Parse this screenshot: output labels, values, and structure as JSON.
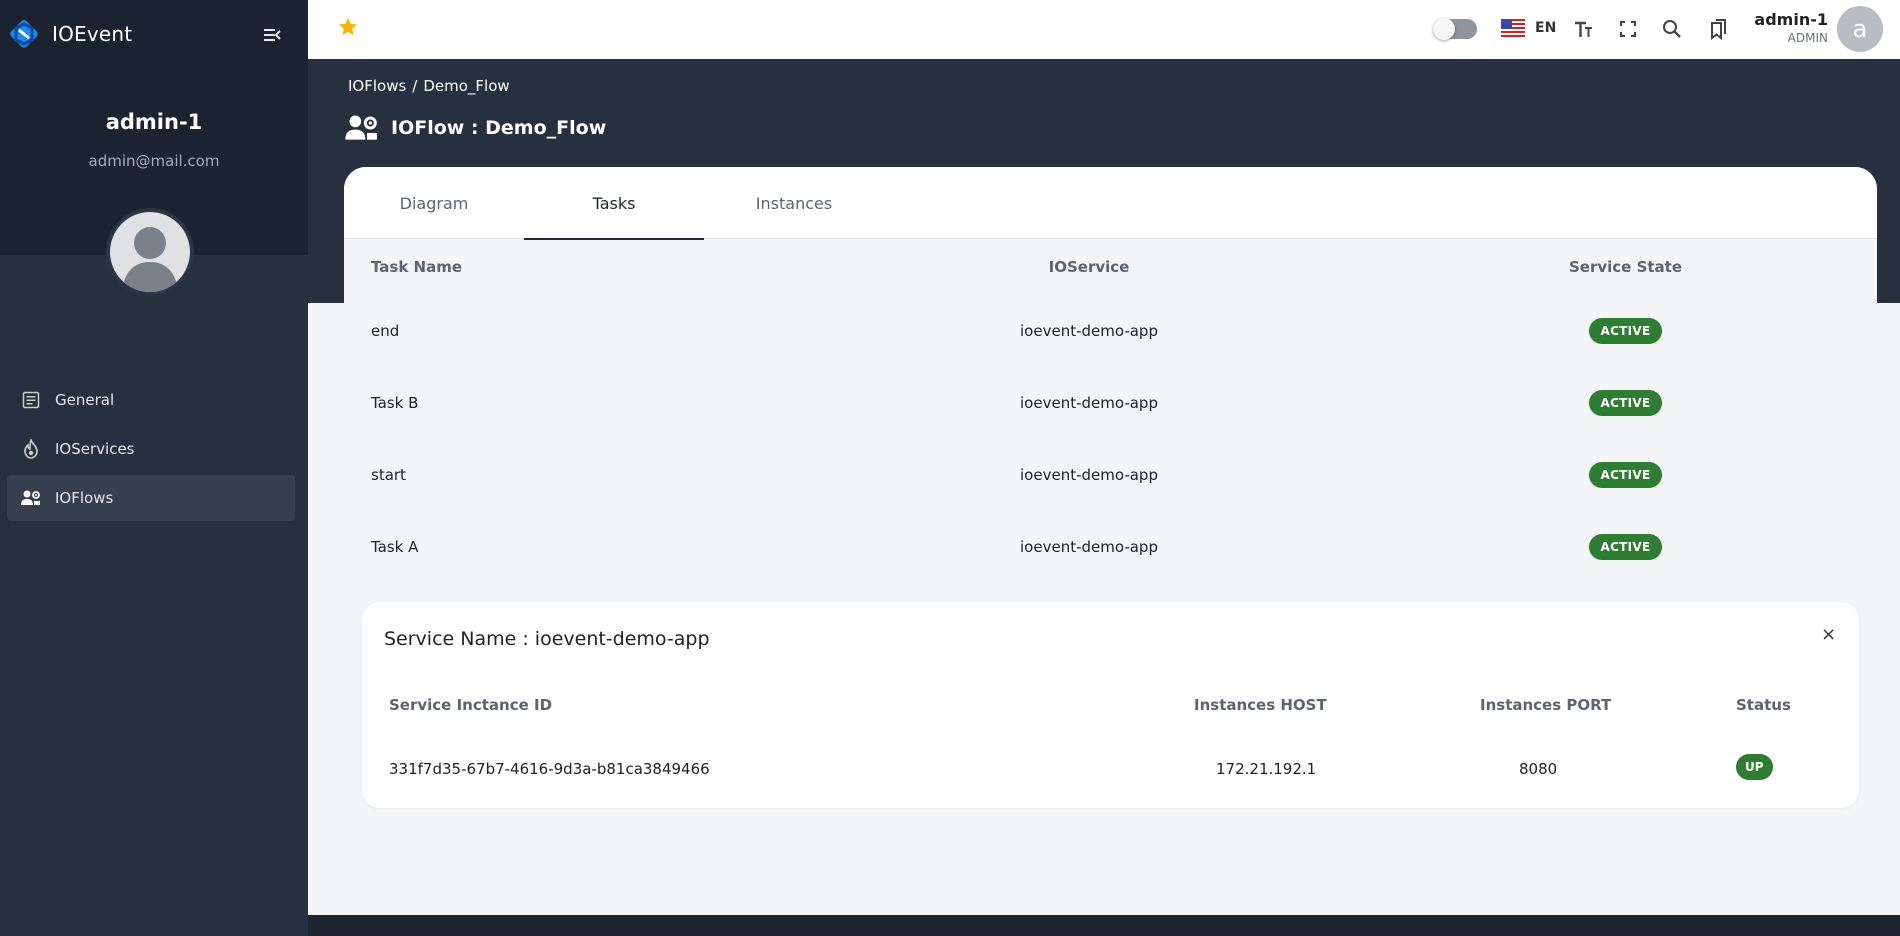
{
  "app": {
    "name": "IOEvent"
  },
  "profile": {
    "name": "admin-1",
    "email": "admin@mail.com"
  },
  "sidebar": {
    "items": [
      {
        "label": "General",
        "icon": "document-icon",
        "active": false
      },
      {
        "label": "IOServices",
        "icon": "flame-icon",
        "active": false
      },
      {
        "label": "IOFlows",
        "icon": "users-gear-icon",
        "active": true
      }
    ]
  },
  "topbar": {
    "language": "EN",
    "user_name": "admin-1",
    "user_role": "ADMIN",
    "avatar_letter": "a",
    "icons": [
      "star-icon",
      "theme-toggle",
      "us-flag-icon",
      "text-size-icon",
      "fullscreen-icon",
      "search-icon",
      "bookmarks-icon"
    ]
  },
  "breadcrumb": {
    "root": "IOFlows",
    "separator": "/",
    "current": "Demo_Flow"
  },
  "page": {
    "title": "IOFlow : Demo_Flow"
  },
  "tabs": [
    {
      "label": "Diagram",
      "active": false
    },
    {
      "label": "Tasks",
      "active": true
    },
    {
      "label": "Instances",
      "active": false
    }
  ],
  "tasks": {
    "headers": {
      "name": "Task Name",
      "service": "IOService",
      "state": "Service State"
    },
    "rows": [
      {
        "name": "end",
        "service": "ioevent-demo-app",
        "state": "ACTIVE"
      },
      {
        "name": "Task B",
        "service": "ioevent-demo-app",
        "state": "ACTIVE"
      },
      {
        "name": "start",
        "service": "ioevent-demo-app",
        "state": "ACTIVE"
      },
      {
        "name": "Task A",
        "service": "ioevent-demo-app",
        "state": "ACTIVE"
      }
    ]
  },
  "service_panel": {
    "title": "Service Name : ioevent-demo-app",
    "close": "×",
    "headers": {
      "id": "Service Inctance ID",
      "host": "Instances HOST",
      "port": "Instances PORT",
      "status": "Status"
    },
    "rows": [
      {
        "id": "331f7d35-67b7-4616-9d3a-b81ca3849466",
        "host": "172.21.192.1",
        "port": "8080",
        "status": "UP"
      }
    ]
  },
  "colors": {
    "sidebar": "#27303f",
    "sidebar_top": "#1b2230",
    "badge_green": "#2e7d32",
    "star": "#f5b400",
    "logo_blue": "#1e88e5"
  }
}
